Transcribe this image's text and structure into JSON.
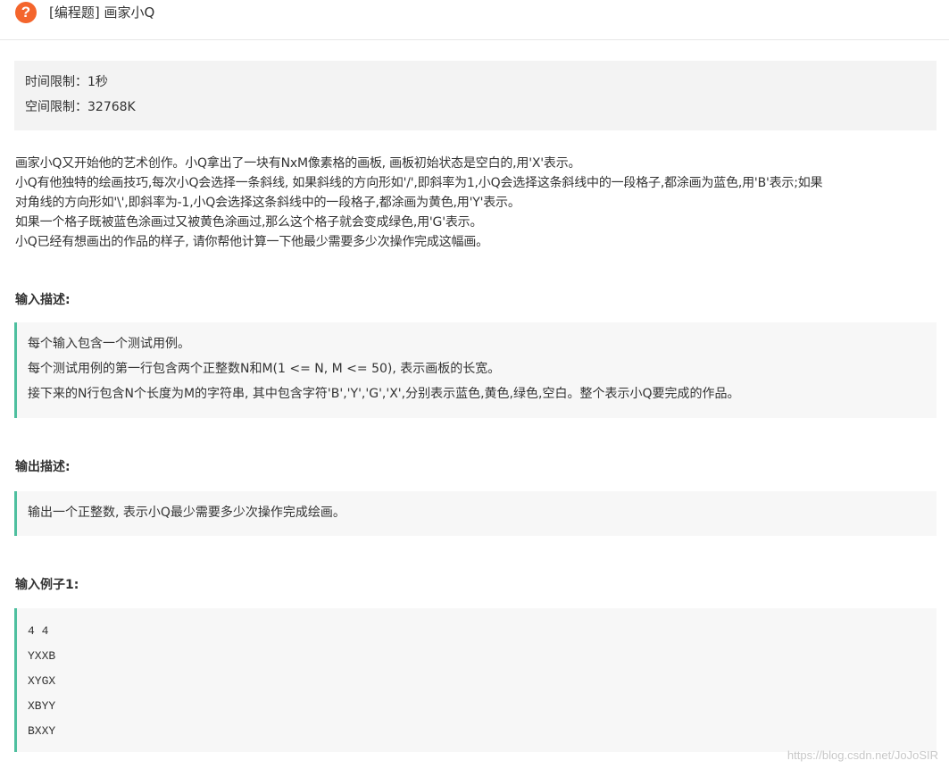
{
  "header": {
    "icon": "help-question-icon",
    "icon_glyph": "?",
    "title": "[编程题] 画家小Q"
  },
  "limits": {
    "time": "时间限制：1秒",
    "space": "空间限制：32768K"
  },
  "description": [
    "画家小Q又开始他的艺术创作。小Q拿出了一块有NxM像素格的画板, 画板初始状态是空白的,用'X'表示。",
    "小Q有他独特的绘画技巧,每次小Q会选择一条斜线, 如果斜线的方向形如'/',即斜率为1,小Q会选择这条斜线中的一段格子,都涂画为蓝色,用'B'表示;如果",
    "对角线的方向形如'\\',即斜率为-1,小Q会选择这条斜线中的一段格子,都涂画为黄色,用'Y'表示。",
    "如果一个格子既被蓝色涂画过又被黄色涂画过,那么这个格子就会变成绿色,用'G'表示。",
    "小Q已经有想画出的作品的样子, 请你帮他计算一下他最少需要多少次操作完成这幅画。"
  ],
  "input_section": {
    "title": "输入描述:",
    "lines": [
      "每个输入包含一个测试用例。",
      "每个测试用例的第一行包含两个正整数N和M(1 <= N, M <= 50), 表示画板的长宽。",
      "接下来的N行包含N个长度为M的字符串, 其中包含字符'B','Y','G','X',分别表示蓝色,黄色,绿色,空白。整个表示小Q要完成的作品。"
    ]
  },
  "output_section": {
    "title": "输出描述:",
    "lines": [
      "输出一个正整数, 表示小Q最少需要多少次操作完成绘画。"
    ]
  },
  "example_section": {
    "title": "输入例子1:",
    "lines": [
      "4 4",
      "YXXB",
      "XYGX",
      "XBYY",
      "BXXY"
    ]
  },
  "watermark": "https://blog.csdn.net/JoJoSIR",
  "colors": {
    "icon_bg": "#f4652c",
    "accent_border": "#4ebf9f",
    "panel_bg": "#f3f3f3",
    "box_bg": "#f7f7f7"
  }
}
